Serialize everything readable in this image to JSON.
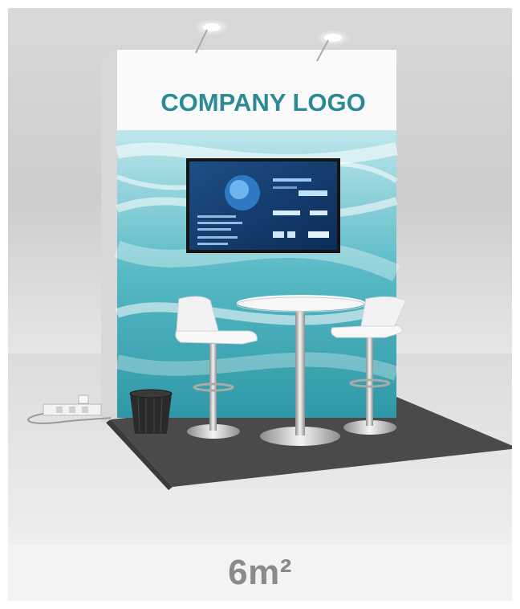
{
  "booth": {
    "logo_text": "COMPANY LOGO",
    "size_label": "6m²"
  },
  "colors": {
    "logo": "#2b8a93",
    "graphic_teal": "#3fa9b5",
    "caption": "#8a8a8a",
    "carpet": "#4a4a4a"
  }
}
